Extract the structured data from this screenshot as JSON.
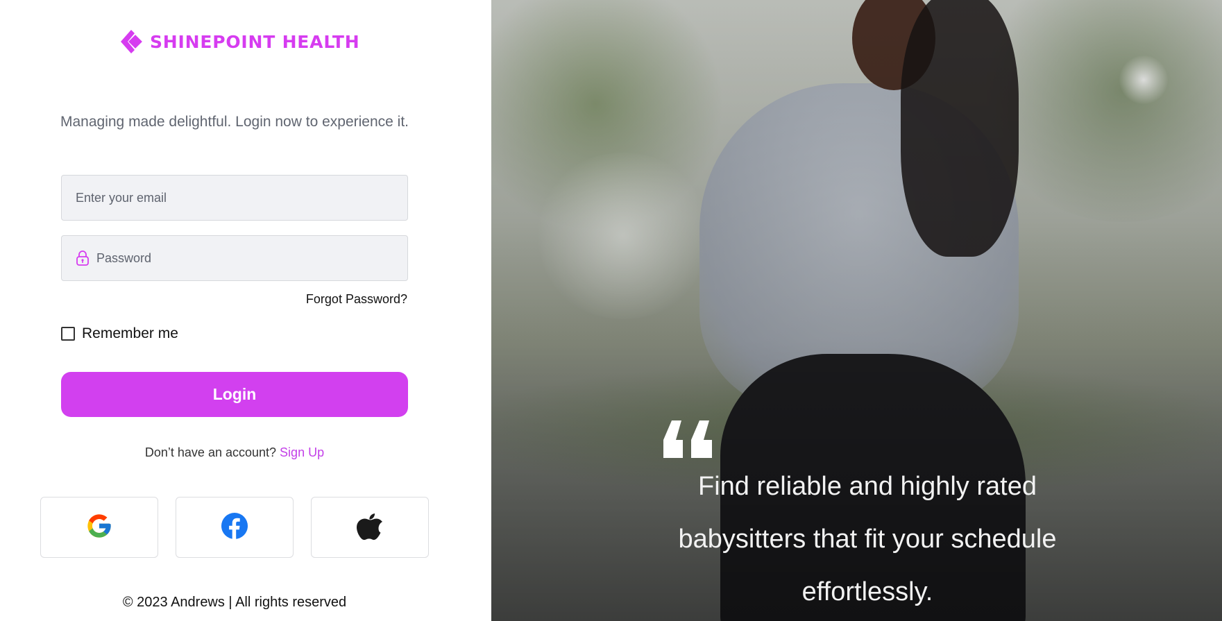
{
  "brand": {
    "name": "SHINEPOINT HEALTH",
    "icon": "diamond-chevron-icon",
    "color": "#d63cf0"
  },
  "tagline": "Managing made delightful. Login now to experience it.",
  "form": {
    "email_placeholder": "Enter your email",
    "password_placeholder": "Password",
    "forgot_password": "Forgot Password?",
    "remember_me": "Remember me",
    "remember_checked": false,
    "login_label": "Login",
    "login_color": "#d240ef"
  },
  "signup": {
    "prompt": "Don’t have an account?",
    "link": "Sign Up"
  },
  "social": [
    {
      "provider": "Google",
      "icon": "google-icon"
    },
    {
      "provider": "Facebook",
      "icon": "facebook-icon"
    },
    {
      "provider": "Apple",
      "icon": "apple-icon"
    }
  ],
  "footer": "© 2023 Andrews | All rights reserved",
  "hero": {
    "quote": "Find reliable and highly rated babysitters that fit your schedule effortlessly.",
    "quote_icon": "quote-mark-icon"
  }
}
